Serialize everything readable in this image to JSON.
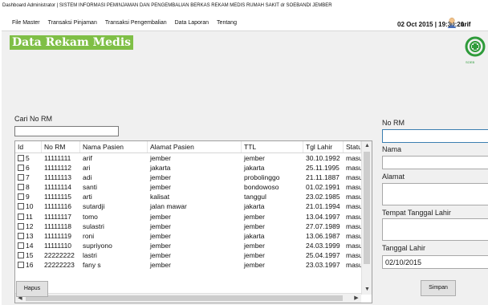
{
  "window": {
    "title": "Dashboard Administrator | SISTEM INFORMASI PEMINJAMAN DAN PENGEMBALIAN BERKAS REKAM MEDIS RUMAH SAKIT dr SOEBANDI JEMBER"
  },
  "menu": [
    "File Master",
    "Transaksi Pinjaman",
    "Transaksi Pengembalian",
    "Data Laporan",
    "Tentang"
  ],
  "header": {
    "datetime": "02 Oct 2015 | 19:30:20",
    "user": "arif",
    "user_icon": "user-icon"
  },
  "page": {
    "title": "Data Rekam Medis",
    "logo_icon": "hospital-logo",
    "logo_text": "SOEB",
    "accent": "#7fbf46"
  },
  "search": {
    "label": "Cari No RM",
    "value": ""
  },
  "table": {
    "columns": [
      "Id",
      "No RM",
      "Nama Pasien",
      "Alamat Pasien",
      "TTL",
      "Tgl Lahir",
      "Statu"
    ],
    "rows": [
      {
        "id": "5",
        "norm": "11111111",
        "nama": "arif",
        "alamat": "jember",
        "ttl": "jember",
        "tgl": "30.10.1992",
        "status": "masu"
      },
      {
        "id": "6",
        "norm": "11111112",
        "nama": "ari",
        "alamat": "jakarta",
        "ttl": "jakarta",
        "tgl": "25.11.1995",
        "status": "masu"
      },
      {
        "id": "7",
        "norm": "11111113",
        "nama": "adi",
        "alamat": "jember",
        "ttl": "probolinggo",
        "tgl": "21.11.1887",
        "status": "masu"
      },
      {
        "id": "8",
        "norm": "11111114",
        "nama": "santi",
        "alamat": "jember",
        "ttl": "bondowoso",
        "tgl": "01.02.1991",
        "status": "masu"
      },
      {
        "id": "9",
        "norm": "11111115",
        "nama": "arti",
        "alamat": "kalisat",
        "ttl": "tanggul",
        "tgl": "23.02.1985",
        "status": "masu"
      },
      {
        "id": "10",
        "norm": "11111116",
        "nama": "sutardji",
        "alamat": "jalan mawar",
        "ttl": "jakarta",
        "tgl": "21.01.1994",
        "status": "masu"
      },
      {
        "id": "11",
        "norm": "11111117",
        "nama": "tomo",
        "alamat": "jember",
        "ttl": "jember",
        "tgl": "13.04.1997",
        "status": "masu"
      },
      {
        "id": "12",
        "norm": "11111118",
        "nama": "sulastri",
        "alamat": "jember",
        "ttl": "jember",
        "tgl": "27.07.1989",
        "status": "masu"
      },
      {
        "id": "13",
        "norm": "11111119",
        "nama": "roni",
        "alamat": "jember",
        "ttl": "jakarta",
        "tgl": "13.06.1987",
        "status": "masu"
      },
      {
        "id": "14",
        "norm": "11111110",
        "nama": "supriyono",
        "alamat": "jember",
        "ttl": "jember",
        "tgl": "24.03.1999",
        "status": "masu"
      },
      {
        "id": "15",
        "norm": "22222222",
        "nama": "lastri",
        "alamat": "jember",
        "ttl": "jember",
        "tgl": "25.04.1997",
        "status": "masu"
      },
      {
        "id": "16",
        "norm": "22222223",
        "nama": "fany s",
        "alamat": "jember",
        "ttl": "jember",
        "tgl": "23.03.1997",
        "status": "masu"
      }
    ]
  },
  "form": {
    "no_rm_label": "No RM",
    "no_rm_value": "",
    "nama_label": "Nama",
    "nama_value": "",
    "alamat_label": "Alamat",
    "alamat_value": "",
    "ttl_label": "Tempat Tanggal Lahir",
    "ttl_value": "",
    "tgl_label": "Tanggal Lahir",
    "tgl_value": "02/10/2015"
  },
  "buttons": {
    "hapus": "Hapus",
    "simpan": "Simpan"
  }
}
